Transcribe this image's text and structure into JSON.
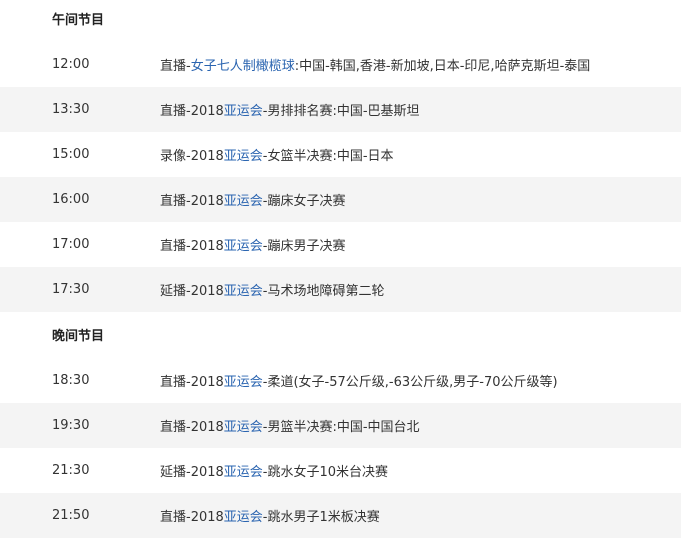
{
  "sections": [
    {
      "title": "午间节目",
      "rows": [
        {
          "time": "12:00",
          "pre": "直播-",
          "link": "女子七人制橄榄球",
          "post": ":中国-韩国,香港-新加坡,日本-印尼,哈萨克斯坦-泰国"
        },
        {
          "time": "13:30",
          "pre": "直播-2018",
          "link": "亚运会",
          "post": "-男排排名赛:中国-巴基斯坦"
        },
        {
          "time": "15:00",
          "pre": "录像-2018",
          "link": "亚运会",
          "post": "-女篮半决赛:中国-日本"
        },
        {
          "time": "16:00",
          "pre": "直播-2018",
          "link": "亚运会",
          "post": "-蹦床女子决赛"
        },
        {
          "time": "17:00",
          "pre": "直播-2018",
          "link": "亚运会",
          "post": "-蹦床男子决赛"
        },
        {
          "time": "17:30",
          "pre": "延播-2018",
          "link": "亚运会",
          "post": "-马术场地障碍第二轮"
        }
      ]
    },
    {
      "title": "晚间节目",
      "rows": [
        {
          "time": "18:30",
          "pre": "直播-2018",
          "link": "亚运会",
          "post": "-柔道(女子-57公斤级,-63公斤级,男子-70公斤级等)"
        },
        {
          "time": "19:30",
          "pre": "直播-2018",
          "link": "亚运会",
          "post": "-男篮半决赛:中国-中国台北"
        },
        {
          "time": "21:30",
          "pre": "延播-2018",
          "link": "亚运会",
          "post": "-跳水女子10米台决赛"
        },
        {
          "time": "21:50",
          "pre": "直播-2018",
          "link": "亚运会",
          "post": "-跳水男子1米板决赛"
        }
      ]
    }
  ],
  "colors": {
    "link": "#2a64b0",
    "alt_row": "#f4f4f4",
    "text": "#333333"
  }
}
